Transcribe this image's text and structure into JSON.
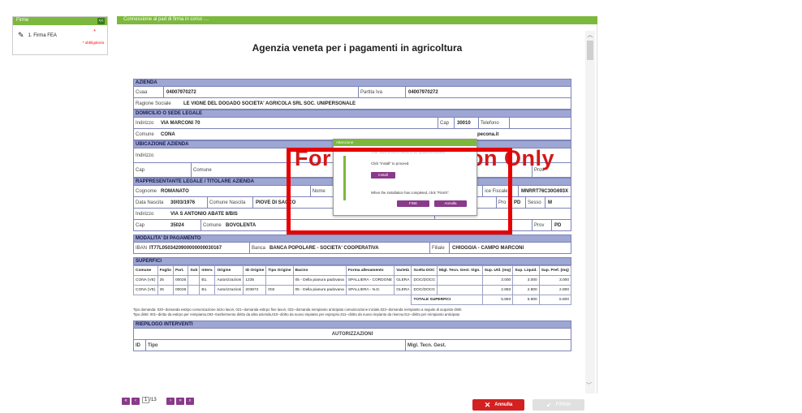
{
  "sidebar": {
    "title": "Firme",
    "collapse_label": "<<",
    "items": [
      {
        "label": "1. Firma FEA",
        "required_mark": "*",
        "required_text": "* obbligatoria"
      }
    ]
  },
  "viewer": {
    "header": "Connessione al pad di firma in corso ....",
    "page_title": "Agenzia veneta per i pagamenti in agricoltura",
    "watermark": "For Demonstration Only",
    "azienda": {
      "section": "AZIENDA",
      "cuaa_label": "Cuaa",
      "cuaa": "04007970272",
      "piva_label": "Partita Iva",
      "piva": "04007970272",
      "rs_label": "Ragione Sociale",
      "rs": "LE VIGNE DEL DOGADO SOCIETA' AGRICOLA SRL SOC. UNIPERSONALE"
    },
    "domicilio": {
      "section": "DOMICILIO O SEDE LEGALE",
      "indirizzo_label": "Indirizzo",
      "indirizzo": "VIA MARCONI 70",
      "cap_label": "Cap",
      "cap": "30010",
      "tel_label": "Telefono",
      "comune_label": "Comune",
      "comune": "CONA",
      "pec": "pecona.it"
    },
    "ubicazione": {
      "section": "UBICAZIONE AZIENDA",
      "indirizzo_label": "Indirizzo",
      "cap_label": "Cap",
      "comune_label": "Comune",
      "prov_label": "Prov"
    },
    "rappresentante": {
      "section": "RAPPRESENTANTE LEGALE / TITOLARE AZIENDA",
      "cognome_label": "Cognome",
      "cognome": "ROMANATO",
      "nome_label": "Nome",
      "cf_label": "ice Fiscale",
      "cf": "MNRRT76C30G693X",
      "nascita_label": "Data Nascita",
      "nascita": "30/03/1976",
      "comune_nascita_label": "Comune Nascita",
      "comune_nascita": "PIOVE DI SACCO",
      "prov_label": "Pro",
      "prov": "PD",
      "sesso_label": "Sesso",
      "sesso": "M",
      "indirizzo_label": "Indirizzo",
      "indirizzo": "VIA S ANTONIO ABATE 8/BIS",
      "tel_label": "Telefono",
      "cap_label": "Cap",
      "cap": "35024",
      "comune_label": "Comune",
      "comune": "BOVOLENTA",
      "prov2_label": "Prov",
      "prov2": "PD"
    },
    "pagamento": {
      "section": "MODALITA' DI PAGAMENTO",
      "iban_label": "IBAN",
      "iban": "IT77L0503420900000000030167",
      "banca_label": "Banca",
      "banca": "BANCA POPOLARE - SOCIETA' COOPERATIVA",
      "filiale_label": "Filiale",
      "filiale": "CHIOGGIA - CAMPO MARCONI"
    },
    "superfici": {
      "section": "SUPERFICI",
      "headers": [
        "Comune",
        "Foglio",
        "Part.",
        "Sub",
        "Interv.",
        "Origine",
        "ID Origine",
        "Tipo Origine",
        "Bacino",
        "Forma allevamento",
        "Varietà",
        "Scelta DOC",
        "Migl. Tecn. Gest. Vign.",
        "Sup. Util. (mq)",
        "Sup. Liquid.",
        "Sup. Pref. (mq)"
      ],
      "rows": [
        [
          "CONA (VE)",
          "25",
          "00026",
          "",
          "B1.",
          "Autorizzazioni",
          "1235",
          "",
          "05 - Della pianura padovana",
          "SPALLIERA - CORDONE",
          "GLERA",
          "DOC/DOCG",
          "",
          "3.000",
          "3.000",
          "3.000"
        ],
        [
          "CONA (VE)",
          "25",
          "00026",
          "",
          "B1.",
          "Autorizzazioni",
          "203672",
          "002",
          "05 - Della pianura padovana",
          "SPALLIERA - N.D.",
          "GLERA",
          "DOC/DOCG",
          "",
          "2.893",
          "2.800",
          "2.800"
        ]
      ],
      "total_label": "TOTALE SUPERFICI",
      "totals": [
        "5.893",
        "5.800",
        "5.800"
      ],
      "note1": "Tipo domanda: 020--domanda estirpo comunicazione inizio lavori, 021--domanda estirpo fine lavori, 022--domanda reimpianto anticipato comunicazione iniziale,023--domanda reimpianto a seguito di acquisto diritti",
      "note2": "Tipo diritti: 001--diritto da estirpo per reimpianto,002--trasferimento diritto da altra azienda,010--diritto da nuovo impianto per esproprio,011--diritto da nuovo impianto da riserva,012--diritto per reimpianto anticipato"
    },
    "riepilogo": {
      "section": "RIEPILOGO INTERVENTI",
      "autorizzazioni": "AUTORIZZAZIONI",
      "col_id": "ID",
      "col_tipo": "Tipo",
      "col_migl": "Migl. Tecn. Gest."
    }
  },
  "dialog": {
    "title": "Attenzione",
    "line1": "Your Java version needs to be updated/installed",
    "line2": "Click \"Install\" to proceed.",
    "install": "Install",
    "line3": "When the installation has completed, click \"Finish\".",
    "fine": "FINE",
    "annulla": "Annulla"
  },
  "footer": {
    "page_current": "1",
    "page_total": "/13",
    "annulla": "Annulla",
    "firma": "FIRMA"
  }
}
